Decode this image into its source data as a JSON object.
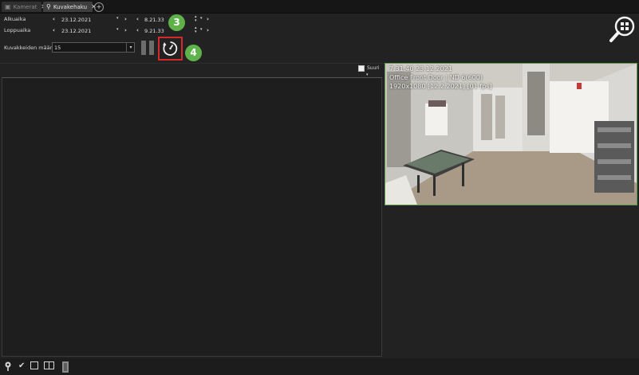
{
  "tabs": [
    {
      "label": "Kamerat",
      "icon": "camera-icon",
      "active": false
    },
    {
      "label": "Kuvakehaku",
      "icon": "search-icon",
      "active": true
    }
  ],
  "start": {
    "label": "Alkuaika",
    "date": "23.12.2021",
    "time": "8.21.33"
  },
  "end": {
    "label": "Loppuaika",
    "date": "23.12.2021",
    "time": "9.21.33"
  },
  "image_count": {
    "label": "Kuvakkeiden määrä",
    "value": "15"
  },
  "large_option": {
    "label": "Suuri",
    "checked": false
  },
  "callouts": [
    "3",
    "4"
  ],
  "preview": {
    "line1": "7.31.40  23.12.2021",
    "line2": "Office Front Door | ND 6(600)",
    "line3": "1920x1080 [12.2.2021] [01 fps]"
  },
  "colors": {
    "highlight": "#d42a2a",
    "callout": "#5fb24a",
    "preview_border": "#5a9a4a"
  }
}
